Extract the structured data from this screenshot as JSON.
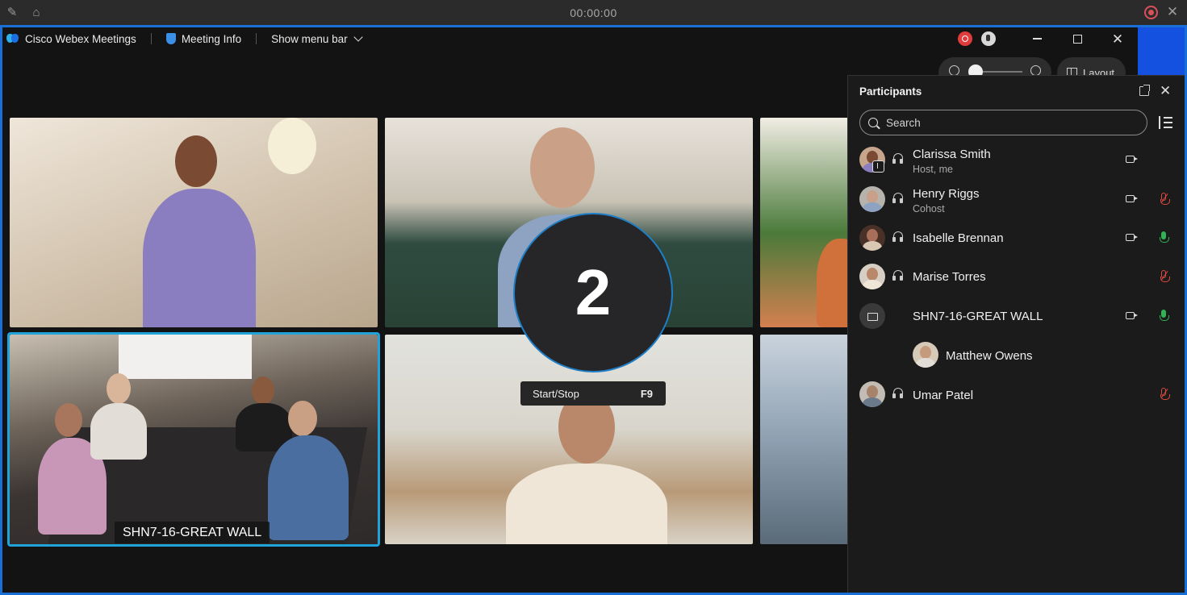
{
  "recorder": {
    "timer": "00:00:00"
  },
  "titlebar": {
    "app_name": "Cisco Webex Meetings",
    "meeting_info": "Meeting Info",
    "show_menu_bar": "Show menu bar"
  },
  "controls": {
    "layout_label": "Layout"
  },
  "video": {
    "active_tile_label": "SHN7-16-GREAT WALL"
  },
  "countdown": {
    "value": "2",
    "tooltip_label": "Start/Stop",
    "tooltip_key": "F9"
  },
  "panel": {
    "title": "Participants",
    "search_placeholder": "Search",
    "participants": [
      {
        "name": "Clarissa Smith",
        "role": "Host, me",
        "video": true,
        "mic": "none"
      },
      {
        "name": "Henry Riggs",
        "role": "Cohost",
        "video": true,
        "mic": "muted"
      },
      {
        "name": "Isabelle Brennan",
        "role": "",
        "video": true,
        "mic": "unmuted"
      },
      {
        "name": "Marise Torres",
        "role": "",
        "video": false,
        "mic": "muted"
      },
      {
        "name": "SHN7-16-GREAT WALL",
        "role": "",
        "video": true,
        "mic": "unmuted"
      },
      {
        "name": "Matthew Owens",
        "role": "",
        "video": false,
        "mic": "none"
      },
      {
        "name": "Umar Patel",
        "role": "",
        "video": false,
        "mic": "muted"
      }
    ]
  },
  "colors": {
    "accent": "#1a6fd6",
    "active_tile": "#1fa3d9",
    "mic_on": "#2fb355",
    "mic_muted": "#e0493e"
  }
}
